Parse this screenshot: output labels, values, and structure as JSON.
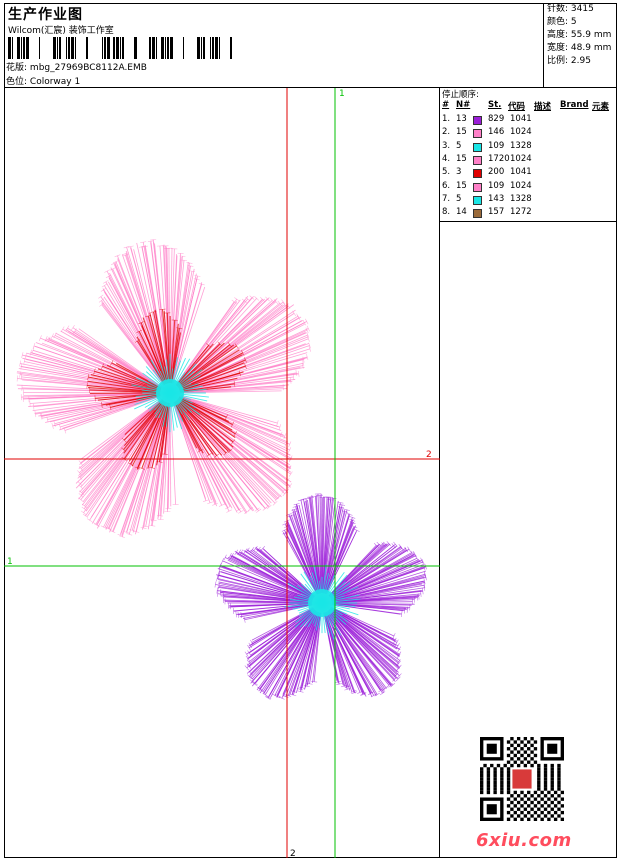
{
  "header": {
    "title": "生产作业图",
    "studio": "Wilcom(汇宸) 装饰工作室",
    "pattern_label": "花版:",
    "pattern_value": "mbg_27969BC8112A.EMB",
    "colorway_label": "色位:",
    "colorway_value": "Colorway 1"
  },
  "stats": [
    {
      "label": "针数:",
      "value": "3415"
    },
    {
      "label": "颜色:",
      "value": "5"
    },
    {
      "label": "高度:",
      "value": "55.9 mm"
    },
    {
      "label": "宽度:",
      "value": "48.9 mm"
    },
    {
      "label": "比例:",
      "value": "2.95"
    }
  ],
  "sequence": {
    "title": "停止顺序:",
    "headers": [
      "#",
      "N#",
      "St.",
      "代码",
      "描述",
      "Brand",
      "元素"
    ],
    "rows": [
      {
        "idx": "1.",
        "n": "13",
        "color": "#9b1ed8",
        "st": "829",
        "code": "1041"
      },
      {
        "idx": "2.",
        "n": "15",
        "color": "#ff80c8",
        "st": "146",
        "code": "1024"
      },
      {
        "idx": "3.",
        "n": "5",
        "color": "#19e6e6",
        "st": "109",
        "code": "1328"
      },
      {
        "idx": "4.",
        "n": "15",
        "color": "#ff80c8",
        "st": "1720",
        "code": "1024"
      },
      {
        "idx": "5.",
        "n": "3",
        "color": "#e00000",
        "st": "200",
        "code": "1041"
      },
      {
        "idx": "6.",
        "n": "15",
        "color": "#ff80c8",
        "st": "109",
        "code": "1024"
      },
      {
        "idx": "7.",
        "n": "5",
        "color": "#19e6e6",
        "st": "143",
        "code": "1328"
      },
      {
        "idx": "8.",
        "n": "14",
        "color": "#9a6a3a",
        "st": "157",
        "code": "1272"
      }
    ]
  },
  "guides": {
    "label_1": "1",
    "label_2": "2"
  },
  "colors": {
    "pink": "#ff80c8",
    "purple": "#9b1ed8",
    "cyan": "#19e6e6",
    "red": "#e00000",
    "guide_red": "#e00000",
    "guide_green": "#00c000"
  },
  "watermark": "6xiu.com"
}
